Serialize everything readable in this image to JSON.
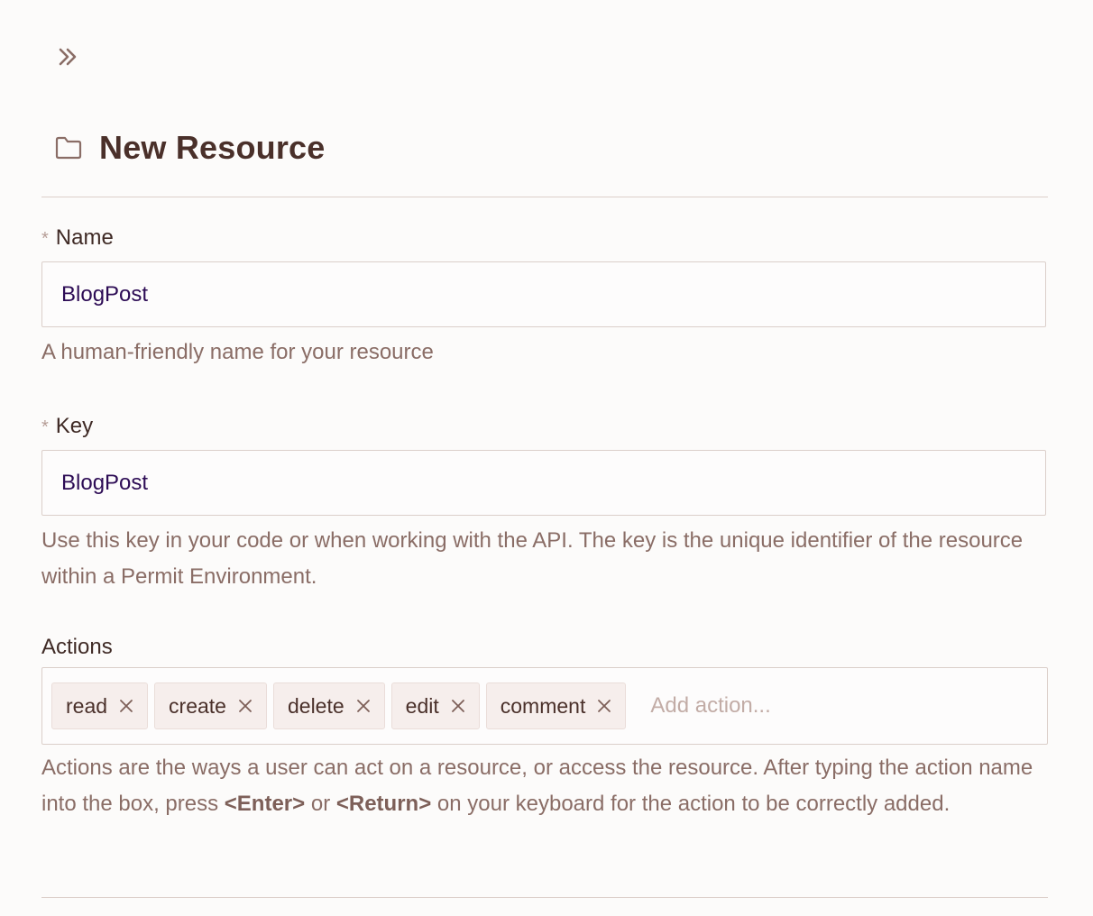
{
  "header": {
    "title": "New Resource",
    "expand_icon": "chevrons-right-icon",
    "title_icon": "folder-icon"
  },
  "form": {
    "name": {
      "required_mark": "*",
      "label": "Name",
      "value": "BlogPost",
      "help": "A human-friendly name for your resource"
    },
    "key": {
      "required_mark": "*",
      "label": "Key",
      "value": "BlogPost",
      "help": "Use this key in your code or when working with the API. The key is the unique identifier of the resource within a Permit Environment."
    },
    "actions": {
      "label": "Actions",
      "chips": [
        {
          "label": "read"
        },
        {
          "label": "create"
        },
        {
          "label": "delete"
        },
        {
          "label": "edit"
        },
        {
          "label": "comment"
        }
      ],
      "placeholder": "Add action...",
      "help_part1": "Actions are the ways a user can act on a resource, or access the resource. After typing the action name into the box, press ",
      "help_key1": "<Enter>",
      "help_part2": " or ",
      "help_key2": "<Return>",
      "help_part3": " on your keyboard for the action to be correctly added."
    }
  },
  "colors": {
    "background": "#fcfbfa",
    "title": "#4a302a",
    "input_text": "#2d0c55",
    "help_text": "#8a6d66",
    "border": "#dbcfca",
    "chip_bg": "#f6eeec"
  }
}
